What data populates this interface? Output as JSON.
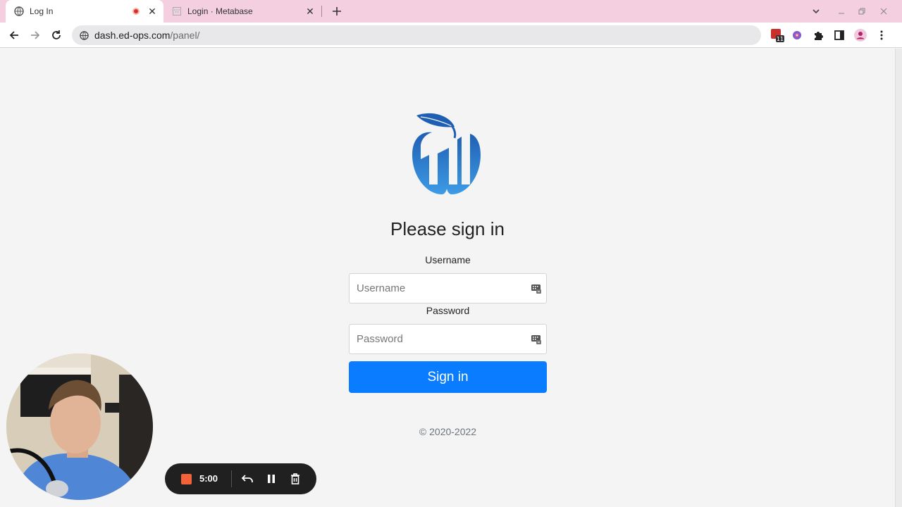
{
  "browser": {
    "tabs": [
      {
        "title": "Log In",
        "active": true,
        "recording": true
      },
      {
        "title": "Login · Metabase",
        "active": false
      }
    ],
    "url_host": "dash.ed-ops.com",
    "url_path": "/panel/",
    "extension_badge": "11"
  },
  "login": {
    "heading": "Please sign in",
    "username_label": "Username",
    "username_placeholder": "Username",
    "password_label": "Password",
    "password_placeholder": "Password",
    "submit_label": "Sign in",
    "copyright": "© 2020-2022"
  },
  "recorder": {
    "time": "5:00"
  },
  "colors": {
    "tabstrip": "#f3cfe0",
    "accent_button": "#0a7cff",
    "logo_blue": "#2a6cc0",
    "record": "#f4623a"
  },
  "icons": [
    "globe-icon",
    "record-dot-icon",
    "close-icon",
    "metabase-icon",
    "plus-icon",
    "chevron-down-icon",
    "minimize-icon",
    "restore-icon",
    "back-arrow-icon",
    "forward-arrow-icon",
    "reload-icon",
    "site-info-icon",
    "calendar-extension-icon",
    "color-extension-icon",
    "puzzle-icon",
    "side-panel-icon",
    "profile-icon",
    "kebab-menu-icon",
    "password-manager-icon",
    "stop-icon",
    "undo-icon",
    "pause-icon",
    "trash-icon"
  ]
}
